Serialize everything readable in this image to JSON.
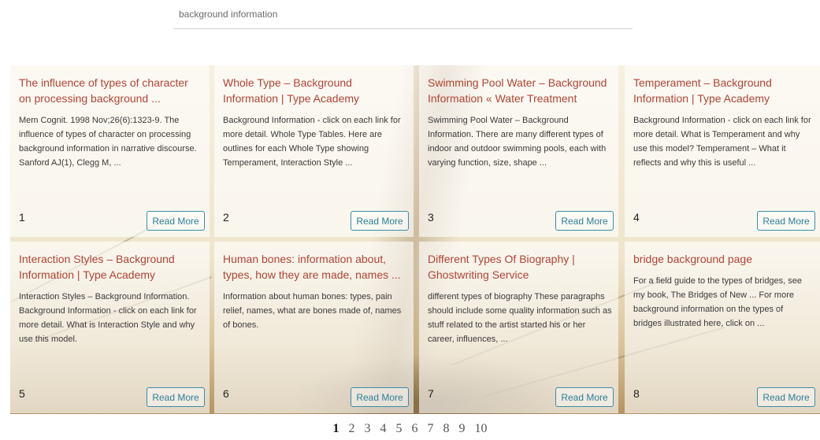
{
  "search": {
    "value": "background information"
  },
  "results": [
    {
      "title": "The influence of types of character on processing background ...",
      "description": "Mem Cognit. 1998 Nov;26(6):1323-9. The influence of types of character on processing background information in narrative discourse. Sanford AJ(1), Clegg M, ...",
      "number": "1",
      "button": "Read More"
    },
    {
      "title": "Whole Type – Background Information | Type Academy",
      "description": "Background Information - click on each link for more detail. Whole Type Tables. Here are outlines for each Whole Type showing Temperament, Interaction Style ...",
      "number": "2",
      "button": "Read More"
    },
    {
      "title": "Swimming Pool Water – Background Information « Water Treatment",
      "description": "Swimming Pool Water – Background Information. There are many different types of indoor and outdoor swimming pools, each with varying function, size, shape ...",
      "number": "3",
      "button": "Read More"
    },
    {
      "title": "Temperament – Background Information | Type Academy",
      "description": "Background Information - click on each link for more detail. What is Temperament and why use this model? Temperament – What it reflects and why this is useful ...",
      "number": "4",
      "button": "Read More"
    },
    {
      "title": "Interaction Styles – Background Information | Type Academy",
      "description": "Interaction Styles – Background Information. Background Information - click on each link for more detail. What is Interaction Style and why use this model.",
      "number": "5",
      "button": "Read More"
    },
    {
      "title": "Human bones: information about, types, how they are made, names ...",
      "description": "Information about human bones: types, pain relief, names, what are bones made of, names of bones.",
      "number": "6",
      "button": "Read More"
    },
    {
      "title": "Different Types Of Biography | Ghostwriting Service",
      "description": "different types of biography These paragraphs should include some quality information such as stuff related to the artist started his or her career, influences, ...",
      "number": "7",
      "button": "Read More"
    },
    {
      "title": "bridge background page",
      "description": "For a field guide to the types of bridges, see my book, The Bridges of New ... For more background information on the types of bridges illustrated here, click on ...",
      "number": "8",
      "button": "Read More"
    }
  ],
  "pagination": {
    "pages": [
      "1",
      "2",
      "3",
      "4",
      "5",
      "6",
      "7",
      "8",
      "9",
      "10"
    ],
    "current": "1"
  },
  "colors": {
    "title": "#b04434",
    "button": "#2d7f9a"
  }
}
